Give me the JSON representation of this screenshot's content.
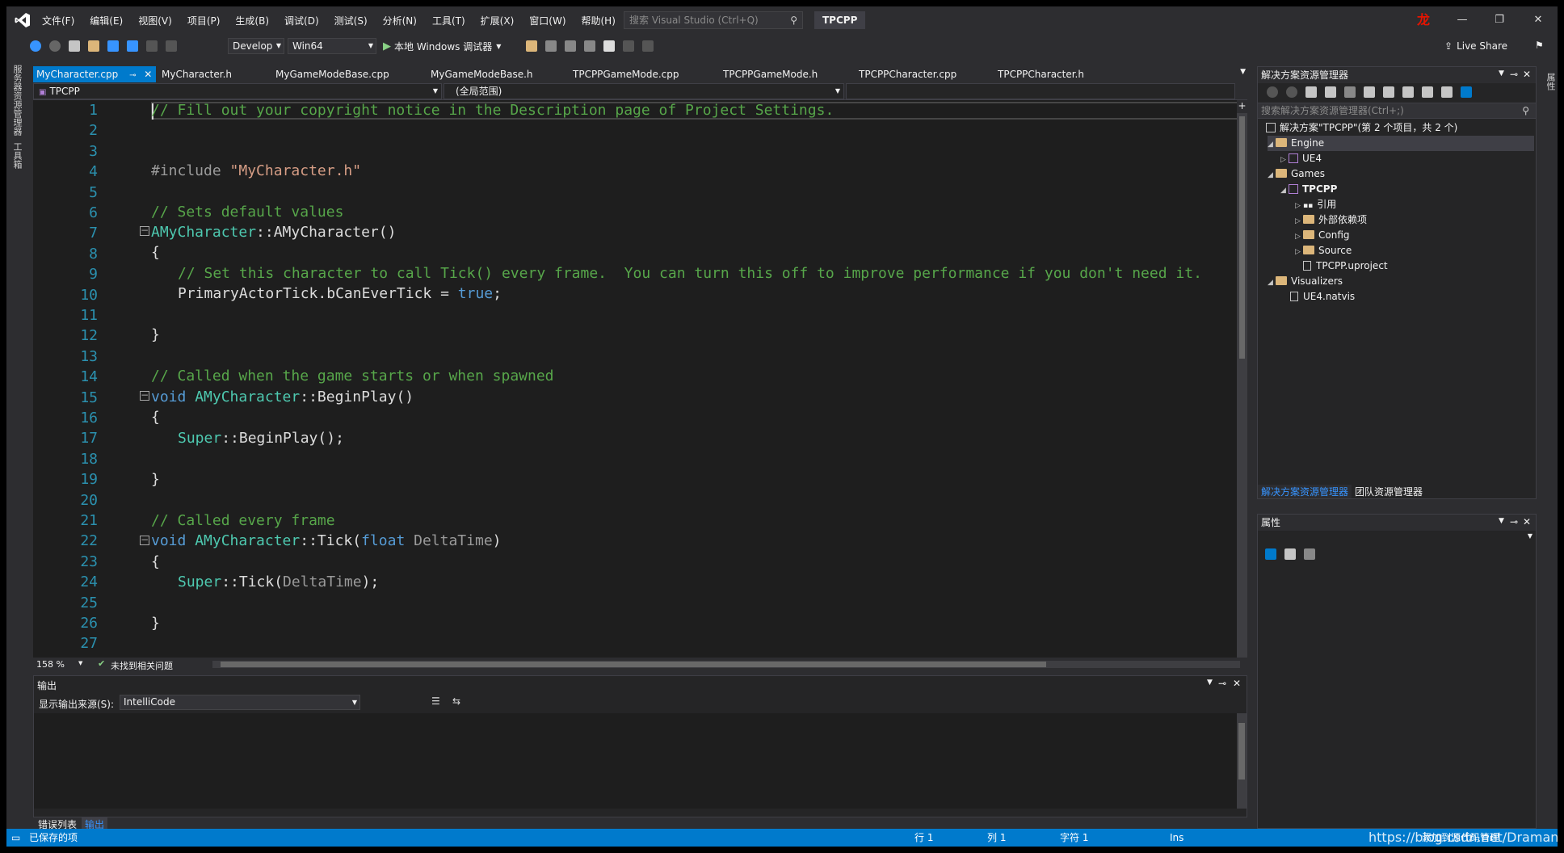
{
  "menu": [
    "文件(F)",
    "编辑(E)",
    "视图(V)",
    "项目(P)",
    "生成(B)",
    "调试(D)",
    "测试(S)",
    "分析(N)",
    "工具(T)",
    "扩展(X)",
    "窗口(W)",
    "帮助(H)"
  ],
  "search_placeholder": "搜索 Visual Studio (Ctrl+Q)",
  "solution_name": "TPCPP",
  "user_avatar": "龙",
  "toolbar": {
    "config": "Develop",
    "platform": "Win64",
    "run_label": "本地 Windows 调试器",
    "live_share": "Live Share"
  },
  "left_tabs": [
    "服务器资源管理器",
    "工具箱"
  ],
  "right_tab": "属性",
  "tabs": [
    {
      "label": "MyCharacter.cpp",
      "active": true
    },
    {
      "label": "MyCharacter.h"
    },
    {
      "label": "MyGameModeBase.cpp"
    },
    {
      "label": "MyGameModeBase.h"
    },
    {
      "label": "TPCPPGameMode.cpp"
    },
    {
      "label": "TPCPPGameMode.h"
    },
    {
      "label": "TPCPPCharacter.cpp"
    },
    {
      "label": "TPCPPCharacter.h"
    }
  ],
  "nav": {
    "project": "TPCPP",
    "scope": "(全局范围)"
  },
  "code": {
    "line_numbers": [
      "1",
      "2",
      "3",
      "4",
      "5",
      "6",
      "7",
      "8",
      "9",
      "10",
      "11",
      "12",
      "13",
      "14",
      "15",
      "16",
      "17",
      "18",
      "19",
      "20",
      "21",
      "22",
      "23",
      "24",
      "25",
      "26",
      "27"
    ],
    "l1": "// Fill out your copyright notice in the Description page of Project Settings.",
    "l4_pp": "#include ",
    "l4_str": "\"MyCharacter.h\"",
    "l6": "// Sets default values",
    "l7_type": "AMyCharacter",
    "l7_rest": "::AMyCharacter()",
    "brace_open": "{",
    "brace_close": "}",
    "l9": "// Set this character to call Tick() every frame.  You can turn this off to improve performance if you don't need it.",
    "l10_a": "PrimaryActorTick.bCanEverTick = ",
    "l10_kw": "true",
    "l10_end": ";",
    "l14": "// Called when the game starts or when spawned",
    "void": "void ",
    "l15_rest": "::BeginPlay()",
    "super": "Super",
    "l17_rest": "::BeginPlay();",
    "l21": "// Called every frame",
    "l22_a": "::Tick(",
    "float": "float ",
    "delta": "DeltaTime",
    "close_paren": ")",
    "l24_a": "::Tick(",
    "l24_end": ");"
  },
  "editor_status": {
    "zoom": "158 %",
    "issues": "未找到相关问题"
  },
  "solution_explorer": {
    "title": "解决方案资源管理器",
    "search": "搜索解决方案资源管理器(Ctrl+;)",
    "root": "解决方案\"TPCPP\"(第 2 个项目，共 2 个)",
    "items": [
      "Engine",
      "UE4",
      "Games",
      "TPCPP",
      "引用",
      "外部依赖项",
      "Config",
      "Source",
      "TPCPP.uproject",
      "Visualizers",
      "UE4.natvis"
    ],
    "bottom_tabs": [
      "解决方案资源管理器",
      "团队资源管理器"
    ]
  },
  "properties": {
    "title": "属性"
  },
  "output": {
    "title": "输出",
    "source_label": "显示输出来源(S):",
    "source": "IntelliCode"
  },
  "bottom_tabs": [
    "错误列表",
    "输出"
  ],
  "statusbar": {
    "saved": "已保存的项",
    "line": "行 1",
    "col": "列 1",
    "char": "字符 1",
    "ins": "Ins",
    "watermark": "https://blog.csdn.net/Draman Fail",
    "source_control": "添加到源代码管理"
  },
  "colors": {
    "accent": "#007acc",
    "editor_bg": "#1e1e1e",
    "comment": "#57a64a",
    "keyword": "#569cd6",
    "type": "#4ec9b0",
    "string": "#d69d85",
    "line_number": "#2b91af"
  }
}
